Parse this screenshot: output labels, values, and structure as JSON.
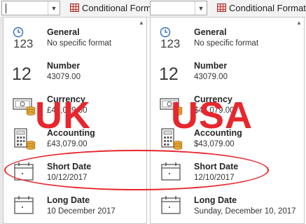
{
  "panes": {
    "uk": {
      "conditional_format_label": "Conditional Form",
      "items": [
        {
          "label": "General",
          "sample": "No specific format"
        },
        {
          "label": "Number",
          "sample": "43079.00"
        },
        {
          "label": "Currency",
          "sample": "£43,079.00"
        },
        {
          "label": "Accounting",
          "sample": " £43,079.00"
        },
        {
          "label": "Short Date",
          "sample": "10/12/2017"
        },
        {
          "label": "Long Date",
          "sample": "10 December 2017"
        }
      ]
    },
    "us": {
      "conditional_format_label": "Conditional Formatti",
      "items": [
        {
          "label": "General",
          "sample": "No specific format"
        },
        {
          "label": "Number",
          "sample": "43079.00"
        },
        {
          "label": "Currency",
          "sample": "$43,079.00"
        },
        {
          "label": "Accounting",
          "sample": " $43,079.00"
        },
        {
          "label": "Short Date",
          "sample": "12/10/2017"
        },
        {
          "label": "Long Date",
          "sample": "Sunday, December 10, 2017"
        }
      ]
    }
  },
  "icons": {
    "general_glyph": "123",
    "number_glyph": "12"
  },
  "annotations": {
    "uk_text": "UK",
    "usa_text": "USA",
    "color": "#e8262d"
  }
}
